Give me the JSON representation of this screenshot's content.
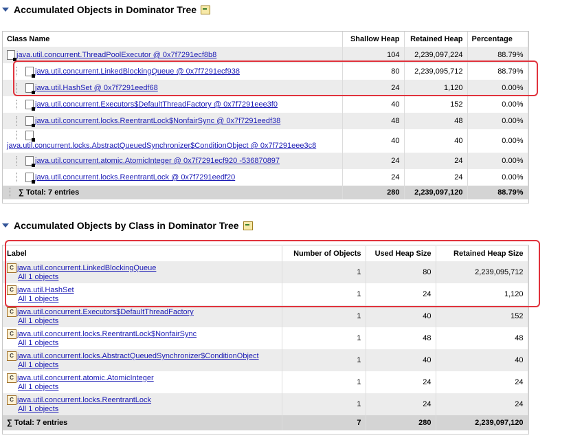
{
  "section1": {
    "title": "Accumulated Objects in Dominator Tree",
    "columns": [
      "Class Name",
      "Shallow Heap",
      "Retained Heap",
      "Percentage"
    ],
    "rows": [
      {
        "name": "java.util.concurrent.ThreadPoolExecutor @ 0x7f7291ecf8b8",
        "shallow": "104",
        "retained": "2,239,097,224",
        "percentage": "88.79%"
      },
      {
        "name": "java.util.concurrent.LinkedBlockingQueue @ 0x7f7291ecf938",
        "shallow": "80",
        "retained": "2,239,095,712",
        "percentage": "88.79%"
      },
      {
        "name": "java.util.HashSet @ 0x7f7291eedf68",
        "shallow": "24",
        "retained": "1,120",
        "percentage": "0.00%"
      },
      {
        "name": "java.util.concurrent.Executors$DefaultThreadFactory @ 0x7f7291eee3f0",
        "shallow": "40",
        "retained": "152",
        "percentage": "0.00%"
      },
      {
        "name": "java.util.concurrent.locks.ReentrantLock$NonfairSync @ 0x7f7291eedf38",
        "shallow": "48",
        "retained": "48",
        "percentage": "0.00%"
      },
      {
        "name": "java.util.concurrent.locks.AbstractQueuedSynchronizer$ConditionObject @ 0x7f7291eee3c8",
        "shallow": "40",
        "retained": "40",
        "percentage": "0.00%"
      },
      {
        "name": "java.util.concurrent.atomic.AtomicInteger @ 0x7f7291ecf920 -536870897",
        "shallow": "24",
        "retained": "24",
        "percentage": "0.00%"
      },
      {
        "name": "java.util.concurrent.locks.ReentrantLock @ 0x7f7291eedf20",
        "shallow": "24",
        "retained": "24",
        "percentage": "0.00%"
      }
    ],
    "total": {
      "label": "Total: 7 entries",
      "shallow": "280",
      "retained": "2,239,097,120",
      "percentage": "88.79%"
    }
  },
  "section2": {
    "title": "Accumulated Objects by Class in Dominator Tree",
    "columns": [
      "Label",
      "Number of Objects",
      "Used Heap Size",
      "Retained Heap Size"
    ],
    "rows": [
      {
        "name": "java.util.concurrent.LinkedBlockingQueue",
        "sub": "All 1 objects",
        "count": "1",
        "used": "80",
        "retained": "2,239,095,712"
      },
      {
        "name": "java.util.HashSet",
        "sub": "All 1 objects",
        "count": "1",
        "used": "24",
        "retained": "1,120"
      },
      {
        "name": "java.util.concurrent.Executors$DefaultThreadFactory",
        "sub": "All 1 objects",
        "count": "1",
        "used": "40",
        "retained": "152"
      },
      {
        "name": "java.util.concurrent.locks.ReentrantLock$NonfairSync",
        "sub": "All 1 objects",
        "count": "1",
        "used": "48",
        "retained": "48"
      },
      {
        "name": "java.util.concurrent.locks.AbstractQueuedSynchronizer$ConditionObject",
        "sub": "All 1 objects",
        "count": "1",
        "used": "40",
        "retained": "40"
      },
      {
        "name": "java.util.concurrent.atomic.AtomicInteger",
        "sub": "All 1 objects",
        "count": "1",
        "used": "24",
        "retained": "24"
      },
      {
        "name": "java.util.concurrent.locks.ReentrantLock",
        "sub": "All 1 objects",
        "count": "1",
        "used": "24",
        "retained": "24"
      }
    ],
    "total": {
      "label": "Total: 7 entries",
      "count": "7",
      "used": "280",
      "retained": "2,239,097,120"
    }
  },
  "colors": {
    "link": "#1a1ab5",
    "highlight": "#e0323c",
    "alt_row": "#ececec",
    "total_row": "#d4d4d4"
  }
}
